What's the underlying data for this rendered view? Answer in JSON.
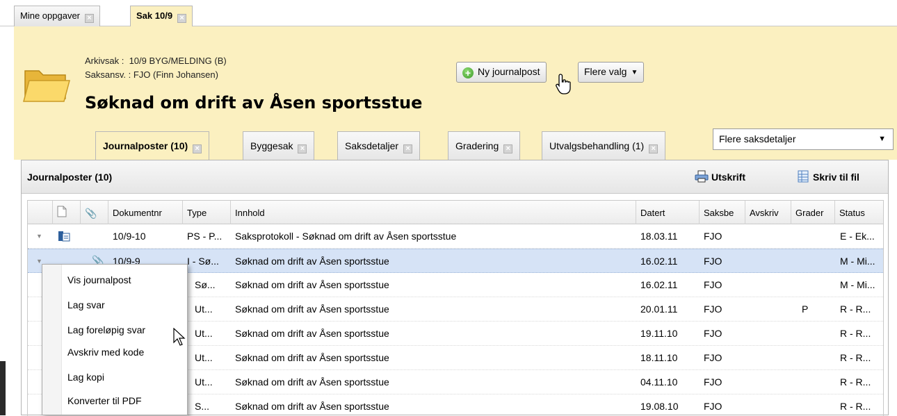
{
  "top_tabs": [
    {
      "label": "Mine oppgaver"
    },
    {
      "label": "Sak 10/9"
    }
  ],
  "case": {
    "arkivsak_label": "Arkivsak :",
    "arkivsak_value": "10/9 BYG/MELDING (B)",
    "saksansv_label": "Saksansv. :",
    "saksansv_value": "FJO (Finn Johansen)",
    "title": "Søknad om drift av Åsen sportsstue"
  },
  "buttons": {
    "new_journal": "Ny journalpost",
    "more_options": "Flere valg"
  },
  "sub_tabs": [
    {
      "label": "Journalposter (10)"
    },
    {
      "label": "Byggesak"
    },
    {
      "label": "Saksdetaljer"
    },
    {
      "label": "Gradering"
    },
    {
      "label": "Utvalgsbehandling (1)"
    }
  ],
  "more_details_select": "Flere saksdetaljer",
  "panel": {
    "title": "Journalposter (10)",
    "print": "Utskrift",
    "write_file": "Skriv til fil"
  },
  "columns": [
    "Dokumentnr",
    "Type",
    "Innhold",
    "Datert",
    "Saksbe",
    "Avskriv",
    "Grader",
    "Status"
  ],
  "rows": [
    {
      "doknr": "10/9-10",
      "type": "PS - P...",
      "innhold": "Saksprotokoll - Søknad om drift av Åsen sportsstue",
      "datert": "18.03.11",
      "saksbe": "FJO",
      "avskriv": "",
      "grader": "",
      "status": "E - Ek..."
    },
    {
      "doknr": "10/9-9",
      "type": "I - Sø...",
      "innhold": "Søknad om drift av Åsen sportsstue",
      "datert": "16.02.11",
      "saksbe": "FJO",
      "avskriv": "",
      "grader": "",
      "status": "M - Mi..."
    },
    {
      "doknr": "",
      "type": "Sø...",
      "innhold": "Søknad om drift av Åsen sportsstue",
      "datert": "16.02.11",
      "saksbe": "FJO",
      "avskriv": "",
      "grader": "",
      "status": "M - Mi..."
    },
    {
      "doknr": "",
      "type": "Ut...",
      "innhold": "Søknad om drift av Åsen sportsstue",
      "datert": "20.01.11",
      "saksbe": "FJO",
      "avskriv": "",
      "grader": "P",
      "status": "R - R..."
    },
    {
      "doknr": "",
      "type": "Ut...",
      "innhold": "Søknad om drift av Åsen sportsstue",
      "datert": "19.11.10",
      "saksbe": "FJO",
      "avskriv": "",
      "grader": "",
      "status": "R - R..."
    },
    {
      "doknr": "",
      "type": "Ut...",
      "innhold": "Søknad om drift av Åsen sportsstue",
      "datert": "18.11.10",
      "saksbe": "FJO",
      "avskriv": "",
      "grader": "",
      "status": "R - R..."
    },
    {
      "doknr": "",
      "type": "Ut...",
      "innhold": "Søknad om drift av Åsen sportsstue",
      "datert": "04.11.10",
      "saksbe": "FJO",
      "avskriv": "",
      "grader": "",
      "status": "R - R..."
    },
    {
      "doknr": "",
      "type": "S...",
      "innhold": "Søknad om drift av Åsen sportsstue",
      "datert": "19.08.10",
      "saksbe": "FJO",
      "avskriv": "",
      "grader": "",
      "status": "R - R..."
    }
  ],
  "context_menu": [
    "Vis journalpost",
    "Lag svar",
    "Lag foreløpig svar",
    "Avskriv med kode",
    "Lag kopi",
    "Konverter til PDF"
  ],
  "colors": {
    "header_bg": "#fbf0c0",
    "selected_row": "#d6e3f6"
  },
  "icons": [
    "close-box-icon",
    "folder-icon",
    "plus-circle-icon",
    "dropdown-caret-icon",
    "hand-cursor-icon",
    "printer-icon",
    "spreadsheet-file-icon",
    "document-icon",
    "paperclip-icon",
    "expand-triangle-icon",
    "arrow-cursor-icon"
  ]
}
